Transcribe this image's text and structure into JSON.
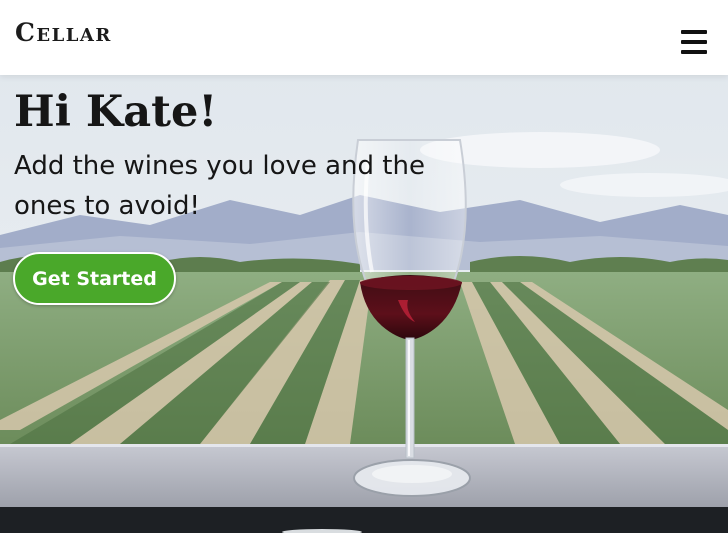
{
  "header": {
    "logo_text": "Cellar",
    "menu_icon": "hamburger-menu-icon"
  },
  "hero": {
    "greeting": "Hi Kate!",
    "subtitle": "Add the wines you love and the ones to avoid!",
    "cta_label": "Get Started",
    "background_image": "vineyard-with-wine-glass"
  },
  "colors": {
    "cta_background": "#4aa82a",
    "header_background": "#ffffff",
    "text": "#161616",
    "bottom_bar": "#1d2024"
  }
}
